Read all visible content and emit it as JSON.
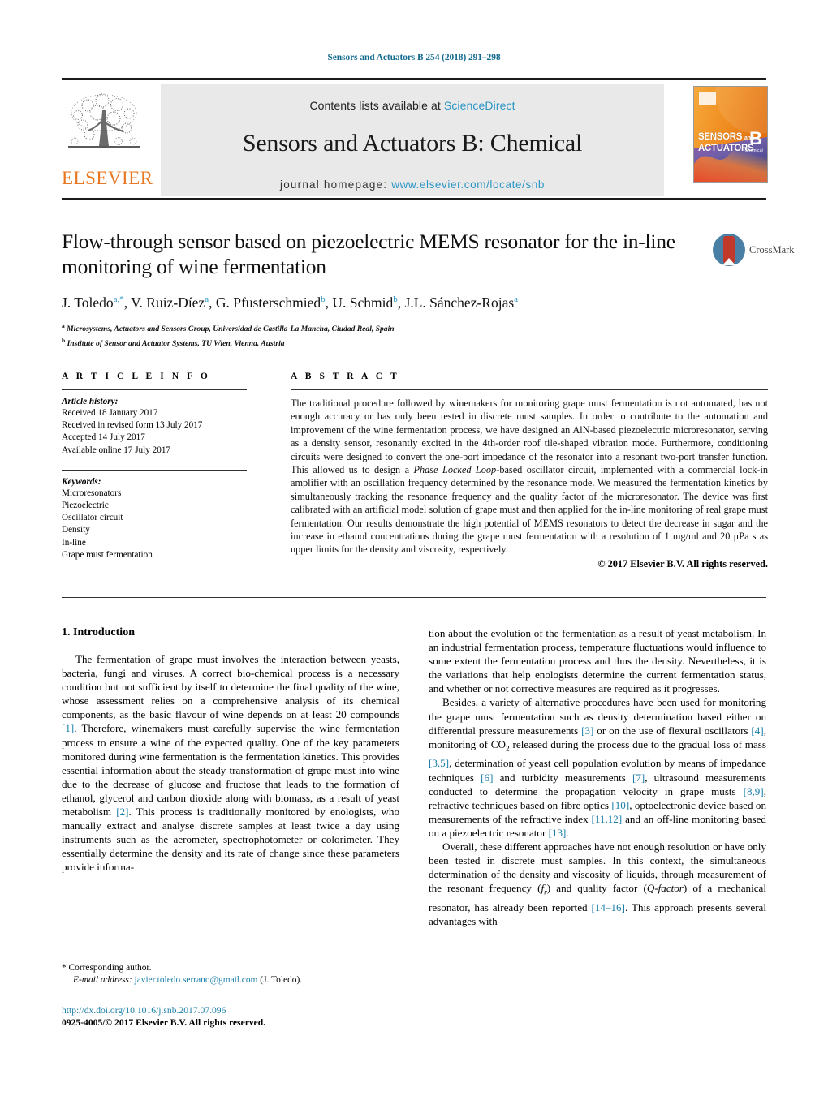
{
  "running_head": "Sensors and Actuators B 254 (2018) 291–298",
  "masthead": {
    "contents_prefix": "Contents lists available at ",
    "sciencedirect": "ScienceDirect",
    "journal_title": "Sensors and Actuators B: Chemical",
    "homepage_label": "journal homepage:",
    "homepage_url": "www.elsevier.com/locate/snb",
    "publisher_logo_text": "ELSEVIER",
    "cover": {
      "line1": "SENSORS",
      "and": "and",
      "line2": "ACTUATORS",
      "volume_letter": "B",
      "volume_sub": "Chemical"
    },
    "accent_link_color": "#2a95c5",
    "band_color": "#e9e9e9",
    "elsevier_orange": "#e87722"
  },
  "article": {
    "title": "Flow-through sensor based on piezoelectric MEMS resonator for the in-line monitoring of wine fermentation",
    "authors_html": "J. Toledo<sup>a,*</sup>, V. Ruiz-Díez<sup>a</sup>, G. Pfusterschmied<sup>b</sup>, U. Schmid<sup>b</sup>, J.L. Sánchez-Rojas<sup>a</sup>",
    "affiliations": [
      {
        "marker": "a",
        "text": "Microsystems, Actuators and Sensors Group, Universidad de Castilla-La Mancha, Ciudad Real, Spain"
      },
      {
        "marker": "b",
        "text": "Institute of Sensor and Actuator Systems, TU Wien, Vienna, Austria"
      }
    ],
    "crossmark_label": "CrossMark"
  },
  "article_info": {
    "heading": "A R T I C L E   I N F O",
    "history_label": "Article history:",
    "history": [
      "Received 18 January 2017",
      "Received in revised form 13 July 2017",
      "Accepted 14 July 2017",
      "Available online 17 July 2017"
    ],
    "keywords_label": "Keywords:",
    "keywords": [
      "Microresonators",
      "Piezoelectric",
      "Oscillator circuit",
      "Density",
      "In-line",
      "Grape must fermentation"
    ]
  },
  "abstract": {
    "heading": "A B S T R A C T",
    "body_html": "The traditional procedure followed by winemakers for monitoring grape must fermentation is not automated, has not enough accuracy or has only been tested in discrete must samples. In order to contribute to the automation and improvement of the wine fermentation process, we have designed an AlN-based piezoelectric microresonator, serving as a density sensor, resonantly excited in the 4th-order roof tile-shaped vibration mode. Furthermore, conditioning circuits were designed to convert the one-port impedance of the resonator into a resonant two-port transfer function. This allowed us to design a <i>Phase Locked Loop</i>-based oscillator circuit, implemented with a commercial lock-in amplifier with an oscillation frequency determined by the resonance mode. We measured the fermentation kinetics by simultaneously tracking the resonance frequency and the quality factor of the microresonator. The device was first calibrated with an artificial model solution of grape must and then applied for the in-line monitoring of real grape must fermentation. Our results demonstrate the high potential of MEMS resonators to detect the decrease in sugar and the increase in ethanol concentrations during the grape must fermentation with a resolution of 1 mg/ml and 20 μPa s as upper limits for the density and viscosity, respectively.",
    "copyright": "© 2017 Elsevier B.V. All rights reserved."
  },
  "introduction": {
    "heading": "1.  Introduction",
    "left_paragraphs_html": [
      "The fermentation of grape must involves the interaction between yeasts, bacteria, fungi and viruses. A correct bio-chemical process is a necessary condition but not sufficient by itself to determine the final quality of the wine, whose assessment relies on a comprehensive analysis of its chemical components, as the basic flavour of wine depends on at least 20 compounds <span class=\"ref\">[1]</span>. Therefore, winemakers must carefully supervise the wine fermentation process to ensure a wine of the expected quality. One of the key parameters monitored during wine fermentation is the fermentation kinetics. This provides essential information about the steady transformation of grape must into wine due to the decrease of glucose and fructose that leads to the formation of ethanol, glycerol and carbon dioxide along with biomass, as a result of yeast metabolism <span class=\"ref\">[2]</span>. This process is traditionally monitored by enologists, who manually extract and analyse discrete samples at least twice a day using instruments such as the aerometer, spectrophotometer or colorimeter. They essentially determine the density and its rate of change since these parameters provide informa-"
    ],
    "right_paragraphs_html": [
      "tion about the evolution of the fermentation as a result of yeast metabolism. In an industrial fermentation process, temperature fluctuations would influence to some extent the fermentation process and thus the density. Nevertheless, it is the variations that help enologists determine the current fermentation status, and whether or not corrective measures are required as it progresses.",
      "Besides, a variety of alternative procedures have been used for monitoring the grape must fermentation such as density determination based either on differential pressure measurements <span class=\"ref\">[3]</span> or on the use of flexural oscillators <span class=\"ref\">[4]</span>, monitoring of CO<sub>2</sub> released during the process due to the gradual loss of mass <span class=\"ref\">[3,5]</span>, determination of yeast cell population evolution by means of impedance techniques <span class=\"ref\">[6]</span> and turbidity measurements <span class=\"ref\">[7]</span>, ultrasound measurements conducted to determine the propagation velocity in grape musts <span class=\"ref\">[8,9]</span>, refractive techniques based on fibre optics <span class=\"ref\">[10]</span>, optoelectronic device based on measurements of the refractive index <span class=\"ref\">[11,12]</span> and an off-line monitoring based on a piezoelectric resonator <span class=\"ref\">[13]</span>.",
      "Overall, these different approaches have not enough resolution or have only been tested in discrete must samples. In this context, the simultaneous determination of the density and viscosity of liquids, through measurement of the resonant frequency (<i>f<sub>r</sub></i>) and quality factor (<i>Q-factor</i>) of a mechanical resonator, has already been reported <span class=\"ref\">[14–16]</span>. This approach presents several advantages with"
    ]
  },
  "footnote": {
    "corresponding_author": "*  Corresponding author.",
    "email_label": "E-mail address:",
    "email": "javier.toledo.serrano@gmail.com",
    "email_owner": "(J. Toledo)."
  },
  "footer": {
    "doi": "http://dx.doi.org/10.1016/j.snb.2017.07.096",
    "issn_line": "0925-4005/© 2017 Elsevier B.V. All rights reserved."
  }
}
